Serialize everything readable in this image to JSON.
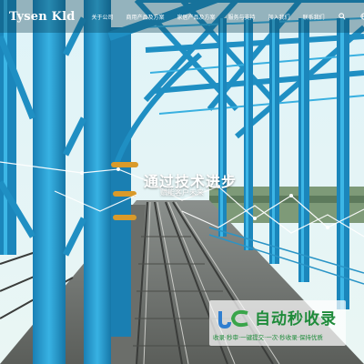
{
  "header": {
    "logo": "Tysen Kld",
    "nav": [
      {
        "label": "关于公司"
      },
      {
        "label": "商用产品及方案"
      },
      {
        "label": "家居产品及方案"
      },
      {
        "label": "服务与支持"
      },
      {
        "label": "加入我们"
      },
      {
        "label": "联系我们"
      }
    ]
  },
  "hero": {
    "headline": "通过技术进步",
    "subhead": "赋能客户未来"
  },
  "watermark": {
    "title": "自动秒收录",
    "subtitle": "收录·秒审·一键提交·一次·秒收录·保持优质"
  },
  "icons": {
    "search": "search-icon",
    "language": "globe-icon"
  },
  "colors": {
    "sky": "#bfe6f2",
    "steel_blue": "#1f8fc3",
    "watermark_green": "#1e8b3a"
  }
}
